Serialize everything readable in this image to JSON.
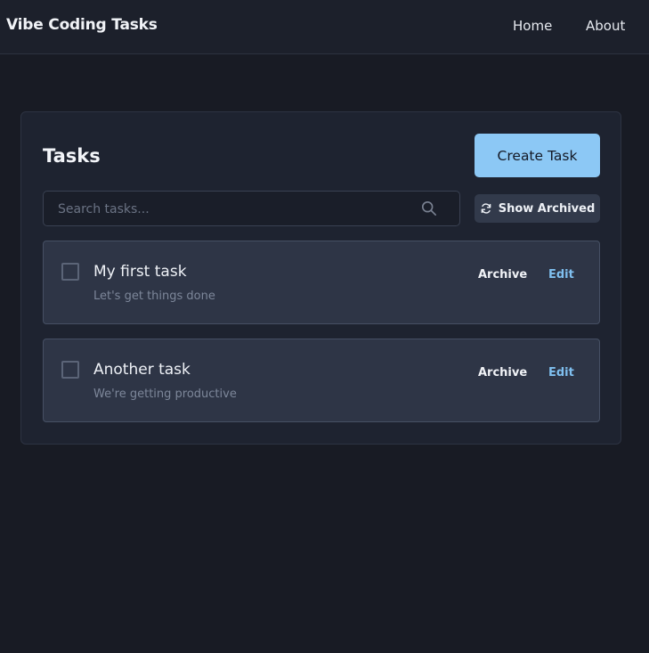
{
  "navbar": {
    "brand": "Vibe Coding Tasks",
    "links": [
      "Home",
      "About"
    ]
  },
  "panel": {
    "title": "Tasks",
    "create_button": "Create Task",
    "search": {
      "placeholder": "Search tasks...",
      "value": ""
    },
    "show_archived_button": "Show Archived",
    "tasks": [
      {
        "title": "My first task",
        "description": "Let's get things done",
        "checked": false,
        "archive_label": "Archive",
        "edit_label": "Edit"
      },
      {
        "title": "Another task",
        "description": "We're getting productive",
        "checked": false,
        "archive_label": "Archive",
        "edit_label": "Edit"
      }
    ]
  },
  "colors": {
    "background": "#181b24",
    "accent": "#8cc8f5",
    "edit_link": "#7fbfef"
  },
  "icons": [
    "search-icon",
    "refresh-icon"
  ]
}
